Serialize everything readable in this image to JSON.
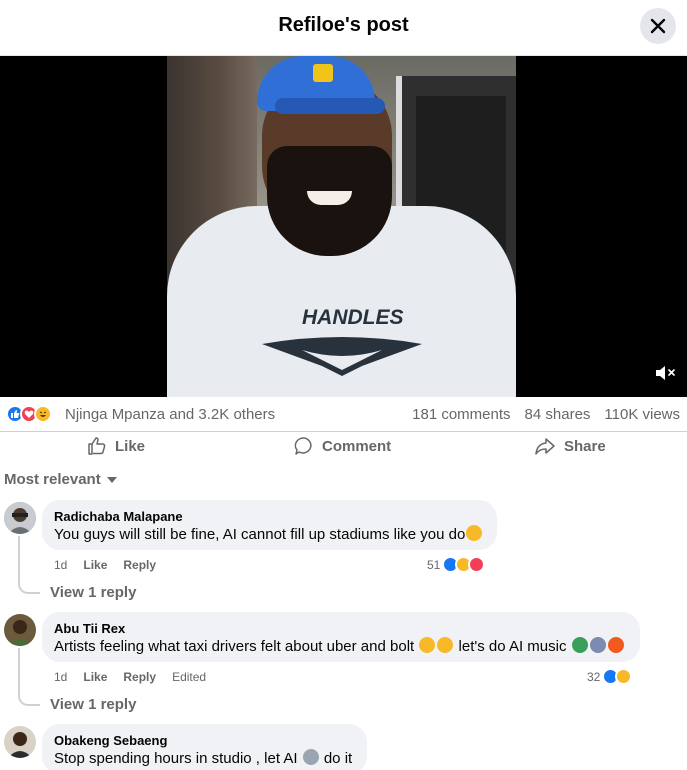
{
  "header": {
    "title": "Refiloe's post"
  },
  "video": {
    "shirt_text": "HANDLES"
  },
  "reactions": {
    "names": "Njinga Mpanza and 3.2K others"
  },
  "stats": {
    "comments": "181 comments",
    "shares": "84 shares",
    "views": "110K views"
  },
  "actions": {
    "like": "Like",
    "comment": "Comment",
    "share": "Share"
  },
  "sort": {
    "label": "Most relevant"
  },
  "comments": [
    {
      "name": "Radichaba Malapane",
      "text": "You guys will still be fine, AI cannot fill up stadiums like you do",
      "time": "1d",
      "like": "Like",
      "reply": "Reply",
      "edited": "",
      "reactions_count": "51",
      "view_replies": "View 1 reply"
    },
    {
      "name": "Abu Tii Rex",
      "text": "Artists feeling what taxi drivers felt about uber and bolt",
      "text2": "let's do AI music",
      "time": "1d",
      "like": "Like",
      "reply": "Reply",
      "edited": "Edited",
      "reactions_count": "32",
      "view_replies": "View 1 reply"
    },
    {
      "name": "Obakeng Sebaeng",
      "text": "Stop spending hours in studio , let AI",
      "text2": "do it"
    }
  ],
  "colors": {
    "accent": "#1877f2",
    "secondary_text": "#65676b",
    "bubble_bg": "#f0f2f5"
  }
}
